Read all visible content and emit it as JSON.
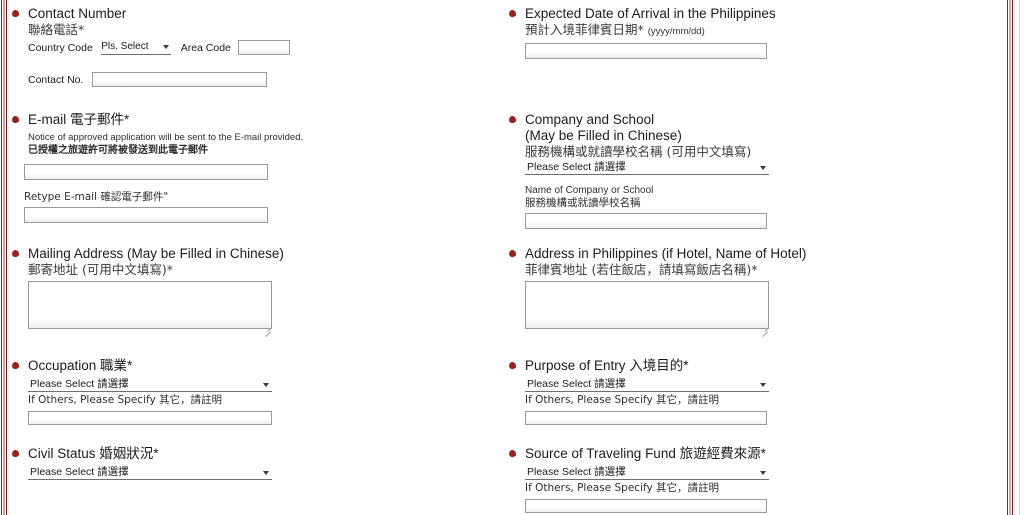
{
  "theme": {
    "accent": "#9c1f1f",
    "border_red": "#8d1b1b",
    "border_pink": "#d8a0a0",
    "field_border": "#9a9a9a"
  },
  "left_column": {
    "contact_number": {
      "label_en": "Contact Number",
      "label_zh": "聯絡電話*",
      "country_code_label": "Country Code",
      "country_code_value": "Pls. Select",
      "area_code_label": "Area Code",
      "area_code_value": "",
      "contact_no_label": "Contact No.",
      "contact_no_value": ""
    },
    "email": {
      "label_en": "E-mail 電子郵件*",
      "note_en": "Notice of approved application will be sent to the E-mail provided.",
      "note_zh": "已授權之旅遊許可將被發送到此電子郵件",
      "email_value": "",
      "retype_label": "Retype E-mail 確認電子郵件\"",
      "retype_value": ""
    },
    "mailing_address": {
      "label_en": "Mailing Address (May be Filled in Chinese)",
      "label_zh": "郵寄地址 (可用中文填寫)*",
      "value": ""
    },
    "occupation": {
      "label_en": "Occupation 職業*",
      "select_value_en": "Please Select ",
      "select_value_zh": "請選擇",
      "others_label": "If Others, Please Specify 其它，請註明",
      "others_value": ""
    },
    "civil_status": {
      "label_en": "Civil Status 婚姻狀況*",
      "select_value_en": "Please Select ",
      "select_value_zh": "請選擇"
    }
  },
  "right_column": {
    "arrival_date": {
      "label_en": "Expected Date of Arrival in the Philippines",
      "label_zh": "預計入境菲律賓日期*",
      "format_hint": "(yyyy/mm/dd)",
      "value": ""
    },
    "company_school": {
      "label_en_line1": "Company and School",
      "label_en_line2": "(May be Filled in Chinese)",
      "label_zh": "服務機構或就讀學校名稱 (可用中文填寫)",
      "select_value_en": "Please Select ",
      "select_value_zh": "請選擇",
      "name_label_en": "Name of Company or School",
      "name_label_zh": "服務機構或就讀學校名稱",
      "name_value": ""
    },
    "ph_address": {
      "label_en": "Address in Philippines (if Hotel, Name of Hotel)",
      "label_zh": "菲律賓地址 (若住飯店，請填寫飯店名稱)*",
      "value": ""
    },
    "purpose_of_entry": {
      "label_en": "Purpose of Entry 入境目的*",
      "select_value_en": "Please Select ",
      "select_value_zh": "請選擇",
      "others_label": "If Others, Please Specify 其它，請註明",
      "others_value": ""
    },
    "source_of_fund": {
      "label_en": "Source of Traveling Fund 旅遊經費來源*",
      "select_value_en": "Please Select ",
      "select_value_zh": "請選擇",
      "others_label": "If Others, Please Specify 其它，請註明",
      "others_value": ""
    }
  }
}
